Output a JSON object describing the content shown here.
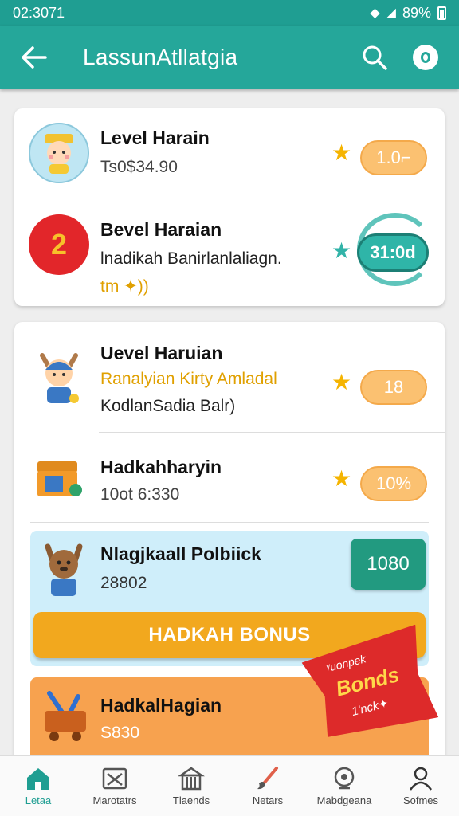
{
  "status_bar": {
    "time": "02:3071",
    "battery": "89%"
  },
  "app_bar": {
    "title": "LassunAtllatgia",
    "back_icon": "arrow-left-icon",
    "search_icon": "search-icon",
    "profile_icon": "profile-icon"
  },
  "card1": {
    "rows": [
      {
        "title": "Level Harain",
        "subtitle": "Ts0$34.90",
        "badge": "1.0⌐",
        "avatar_icon": "kid-avatar-icon"
      },
      {
        "title": "Bevel Haraian",
        "subtitle": "lnadikah Banirlanlaliagn.",
        "extra": "tm ✦))",
        "badge": "31:0d",
        "avatar_icon": "number-two-badge-icon"
      }
    ]
  },
  "card2": {
    "rows": [
      {
        "title": "Uevel Haruian",
        "subtitle": "Ranalyian Kirty Amladal",
        "extra": "KodlanSadia Balr)",
        "badge": "18",
        "avatar_icon": "boy-avatar-icon"
      },
      {
        "title": "Hadkahharyin",
        "subtitle": "10ot 6:330",
        "badge": "10%",
        "avatar_icon": "treasure-box-icon"
      }
    ],
    "bonus": {
      "title": "Nlagjkaall Polbiick",
      "value": "28802",
      "green_button": "1080",
      "orange_button": "HADKAH BONUS"
    },
    "last": {
      "title": "HadkalHagian",
      "subtitle": "S830"
    }
  },
  "ribbon": {
    "line1": "ᵞuonpek",
    "line2": "Bonds",
    "line3": "1'nck✦"
  },
  "bottom_nav": [
    {
      "label": "Letaa",
      "icon": "home-icon",
      "active": true
    },
    {
      "label": "Marotatrs",
      "icon": "image-icon",
      "active": false
    },
    {
      "label": "Tlaends",
      "icon": "store-icon",
      "active": false
    },
    {
      "label": "Netars",
      "icon": "brush-icon",
      "active": false
    },
    {
      "label": "Mabdgeana",
      "icon": "magnifier-icon",
      "active": false
    },
    {
      "label": "Sofmes",
      "icon": "person-icon",
      "active": false
    }
  ],
  "colors": {
    "primary": "#25a79a",
    "accent_orange": "#f2a81e",
    "star": "#f5b400",
    "pill": "#fbc171",
    "green_button": "#229a80",
    "ribbon": "#dd2a2a"
  }
}
